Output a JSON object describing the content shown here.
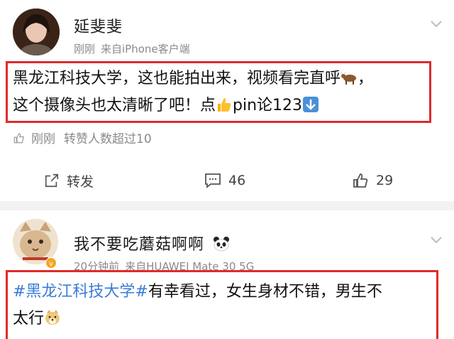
{
  "post1": {
    "username": "延斐斐",
    "time": "刚刚",
    "source": "来自iPhone客户端",
    "content_line1": "黑龙江科技大学，这也能拍出来，视频看完直呼",
    "content_line1_end": "，",
    "content_line2_a": "这个摄像头也太清晰了吧！点",
    "content_line2_b": "pin论123",
    "like_context_time": "刚刚",
    "like_context_text": "转赞人数超过10",
    "actions": {
      "repost_label": "转发",
      "comment_count": "46",
      "like_count": "29"
    }
  },
  "post2": {
    "username": "我不要吃蘑菇啊啊",
    "time": "20分钟前",
    "source": "来自HUAWEI Mate 30 5G",
    "hashtag": "#黑龙江科技大学#",
    "content_after_tag": "有幸看过，女生身材不错，男生不",
    "content_line2": "太行"
  },
  "colors": {
    "highlight_border": "#e02a2a",
    "hashtag": "#3b7bd6",
    "meta_gray": "#8a8a8a"
  },
  "icons": [
    "chevron-down-icon",
    "cow-emoji",
    "thumbs-up-emoji",
    "down-arrow-emoji",
    "like-context-icon",
    "repost-icon",
    "comment-icon",
    "like-icon",
    "panda-emoji",
    "verified-badge-icon",
    "doge-emoji"
  ]
}
